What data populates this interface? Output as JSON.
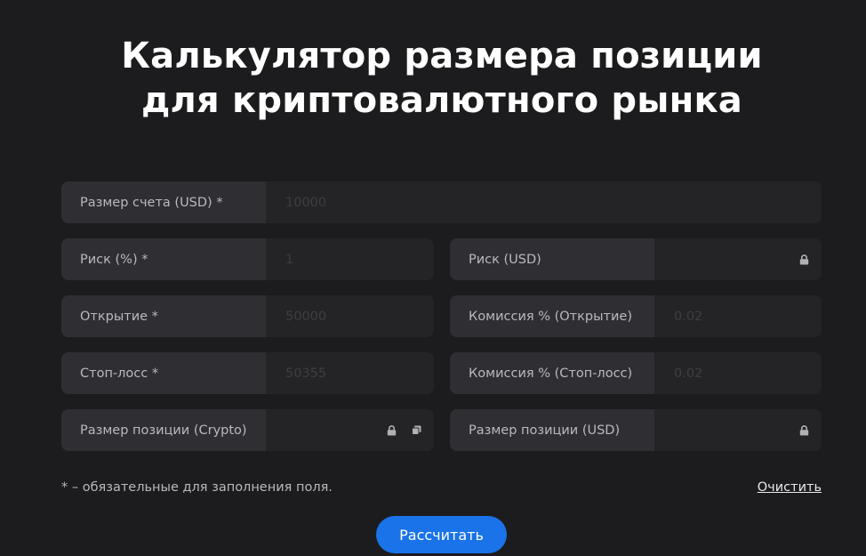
{
  "title": {
    "line1": "Калькулятор размера позиции",
    "line2": "для криптовалютного рынка"
  },
  "fields": {
    "account_size": {
      "label": "Размер счета (USD) *",
      "placeholder": "10000"
    },
    "risk_percent": {
      "label": "Риск (%) *",
      "placeholder": "1"
    },
    "risk_usd": {
      "label": "Риск (USD)",
      "placeholder": ""
    },
    "open_price": {
      "label": "Открытие *",
      "placeholder": "50000"
    },
    "commission_open": {
      "label": "Комиссия % (Открытие)",
      "placeholder": "0.02"
    },
    "stop_loss": {
      "label": "Стоп-лосс *",
      "placeholder": "50355"
    },
    "commission_stop": {
      "label": "Комиссия % (Стоп-лосс)",
      "placeholder": "0.02"
    },
    "position_crypto": {
      "label": "Размер позиции (Crypto)",
      "placeholder": ""
    },
    "position_usd": {
      "label": "Размер позиции (USD)",
      "placeholder": ""
    }
  },
  "footer": {
    "note": "* – обязательные для заполнения поля.",
    "clear_label": "Очистить",
    "calculate_label": "Рассчитать"
  },
  "colors": {
    "background": "#1c1c1e",
    "accent": "#1a73e8"
  },
  "icons": {
    "locked": "lock-icon",
    "copy": "copy-icon"
  }
}
